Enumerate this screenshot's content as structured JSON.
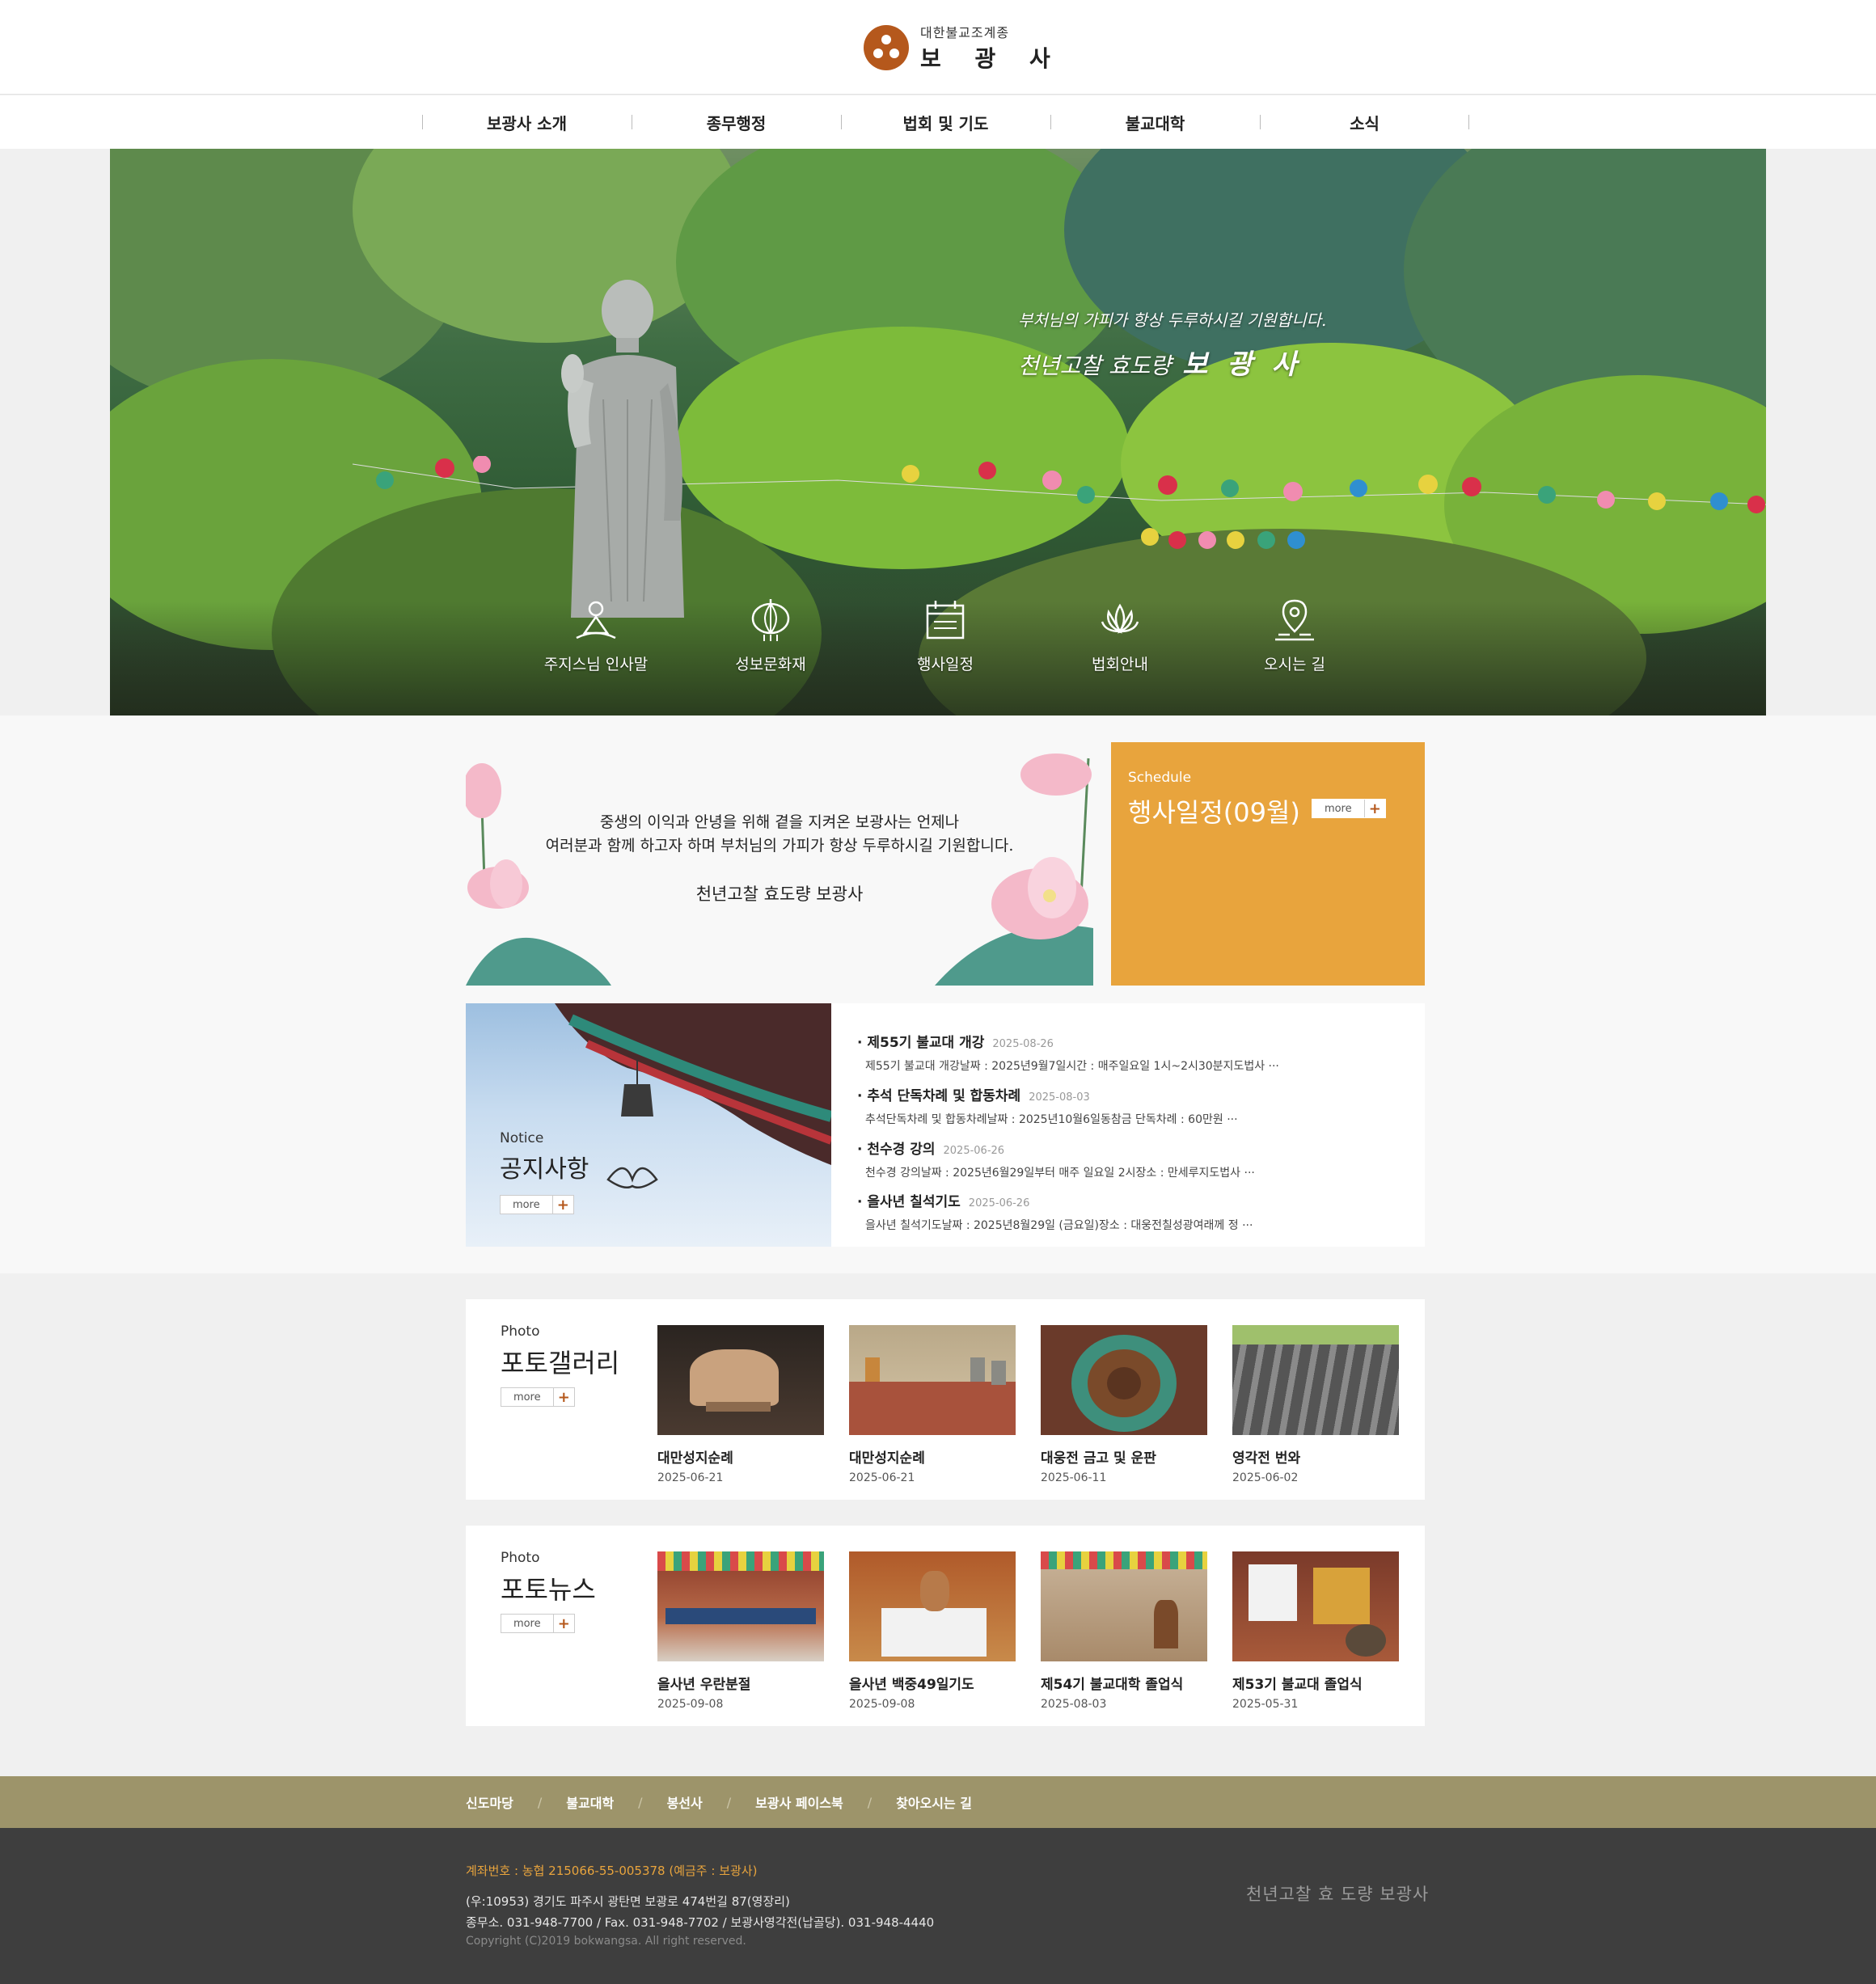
{
  "header": {
    "logo_sub": "대한불교조계종",
    "logo_main": "보 광 사"
  },
  "nav": {
    "items": [
      {
        "label": "보광사 소개"
      },
      {
        "label": "종무행정"
      },
      {
        "label": "법회 및 기도"
      },
      {
        "label": "불교대학"
      },
      {
        "label": "소식"
      }
    ]
  },
  "hero": {
    "caption_line1": "부처님의 가피가 항상 두루하시길 기원합니다.",
    "caption_line2": "천년고찰 효도량",
    "caption_name": "보 광 사",
    "quick_links": [
      {
        "label": "주지스님 인사말",
        "icon": "monk-icon"
      },
      {
        "label": "성보문화재",
        "icon": "lantern-icon"
      },
      {
        "label": "행사일정",
        "icon": "calendar-icon"
      },
      {
        "label": "법회안내",
        "icon": "lotus-icon"
      },
      {
        "label": "오시는 길",
        "icon": "map-pin-icon"
      }
    ]
  },
  "greeting": {
    "line1": "중생의 이익과 안녕을 위해 곁을 지켜온 보광사는 언제나",
    "line2": "여러분과 함께 하고자 하며 부처님의 가피가 항상 두루하시길 기원합니다.",
    "signature": "천년고찰 효도량 보광사"
  },
  "schedule": {
    "label_en": "Schedule",
    "title": "행사일정(09월)",
    "more": "more",
    "more_icon": "+"
  },
  "notice": {
    "label_en": "Notice",
    "title": "공지사항",
    "more": "more",
    "more_icon": "+",
    "items": [
      {
        "title": "제55기 불교대 개강",
        "date": "2025-08-26",
        "summary": "제55기 불교대 개강날짜 : 2025년9월7일시간 : 매주일요일 1시~2시30분지도법사 ···"
      },
      {
        "title": "추석 단독차례 및 합동차례",
        "date": "2025-08-03",
        "summary": "추석단독차례 및 합동차례날짜 : 2025년10월6일동참금 단독차례 : 60만원 ···"
      },
      {
        "title": "천수경 강의",
        "date": "2025-06-26",
        "summary": "천수경 강의날짜 : 2025년6월29일부터 매주 일요일 2시장소 : 만세루지도법사 ···"
      },
      {
        "title": "을사년 칠석기도",
        "date": "2025-06-26",
        "summary": "을사년 칠석기도날짜 : 2025년8월29일 (금요일)장소 : 대웅전칠성광여래께 정 ···"
      }
    ]
  },
  "gallery": {
    "label_en": "Photo",
    "title": "포토갤러리",
    "more": "more",
    "more_icon": "+",
    "items": [
      {
        "caption": "대만성지순례",
        "date": "2025-06-21"
      },
      {
        "caption": "대만성지순례",
        "date": "2025-06-21"
      },
      {
        "caption": "대웅전 금고 및 운판",
        "date": "2025-06-11"
      },
      {
        "caption": "영각전 번와",
        "date": "2025-06-02"
      }
    ]
  },
  "news": {
    "label_en": "Photo",
    "title": "포토뉴스",
    "more": "more",
    "more_icon": "+",
    "items": [
      {
        "caption": "을사년 우란분절",
        "date": "2025-09-08"
      },
      {
        "caption": "을사년 백중49일기도",
        "date": "2025-09-08"
      },
      {
        "caption": "제54기 불교대학 졸업식",
        "date": "2025-08-03"
      },
      {
        "caption": "제53기 불교대 졸업식",
        "date": "2025-05-31"
      }
    ]
  },
  "footer_nav": {
    "separator": "/",
    "items": [
      {
        "label": "신도마당"
      },
      {
        "label": "불교대학"
      },
      {
        "label": "봉선사"
      },
      {
        "label": "보광사 페이스북"
      },
      {
        "label": "찾아오시는 길"
      }
    ]
  },
  "footer": {
    "account": "계좌번호 : 농협 215066-55-005378 (예금주 : 보광사)",
    "address": "(우:10953) 경기도 파주시 광탄면 보광로 474번길 87(영장리)",
    "phone": "종무소. 031-948-7700 / Fax. 031-948-7702 / 보광사영각전(납골당). 031-948-4440",
    "copyright": "Copyright (C)2019 bokwangsa. All right reserved.",
    "slogan": "천년고찰 효 도량 보광사"
  },
  "colors": {
    "brand": "#b5581c",
    "schedule_bg": "#e8a43d",
    "footer_nav_bg": "#9d946a",
    "footer_bg": "#3e3e3e"
  }
}
